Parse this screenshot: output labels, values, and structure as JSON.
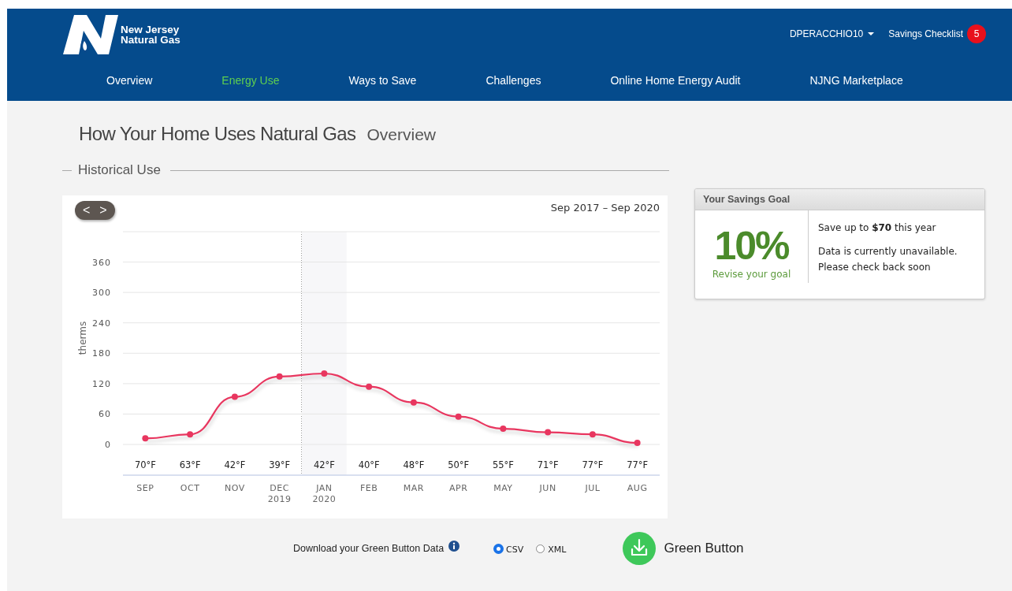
{
  "header": {
    "logo_text": [
      "New Jersey",
      "Natural Gas"
    ],
    "user_menu": "DPERACCHIO10",
    "checklist": {
      "label": "Savings Checklist",
      "count": "5"
    }
  },
  "nav": [
    {
      "label": "Overview",
      "selected": false
    },
    {
      "label": "Energy Use",
      "selected": true
    },
    {
      "label": "Ways to Save",
      "selected": false
    },
    {
      "label": "Challenges",
      "selected": false
    },
    {
      "label": "Online Home Energy Audit",
      "selected": false
    },
    {
      "label": "NJNG Marketplace",
      "selected": false
    }
  ],
  "page": {
    "title": "How Your Home Uses Natural Gas",
    "subtitle": "Overview"
  },
  "historical_use": {
    "heading": "Historical Use",
    "prev": "<",
    "next": ">",
    "range": "Sep 2017 – Sep 2020",
    "temperatures": [
      "70°F",
      "63°F",
      "42°F",
      "39°F",
      "42°F",
      "40°F",
      "48°F",
      "50°F",
      "55°F",
      "71°F",
      "77°F",
      "77°F"
    ],
    "chart_data": {
      "type": "line",
      "ylabel": "therms",
      "categories": [
        "SEP",
        "OCT",
        "NOV",
        "DEC 2019",
        "JAN 2020",
        "FEB",
        "MAR",
        "APR",
        "MAY",
        "JUN",
        "JUL",
        "AUG"
      ],
      "series": [
        {
          "color": "#e8365f",
          "marker": "circle",
          "values": [
            12,
            20,
            94,
            134,
            140,
            114,
            83,
            55,
            31,
            24,
            20,
            3
          ]
        }
      ],
      "ylim": [
        0,
        420
      ],
      "yticks": [
        0,
        60,
        120,
        180,
        240,
        300,
        360
      ],
      "grid": true
    }
  },
  "savings_goal": {
    "title": "Your Savings Goal",
    "percent": "10%",
    "revise": "Revise your goal",
    "save": "Save up to **$70** this year",
    "message": [
      "Data is currently unavailable.",
      "Please check back soon"
    ]
  },
  "download": {
    "label": "Download your Green Button Data",
    "formats": [
      {
        "label": "CSV",
        "selected": true
      },
      {
        "label": "XML",
        "selected": false
      }
    ],
    "button": "Green Button"
  }
}
